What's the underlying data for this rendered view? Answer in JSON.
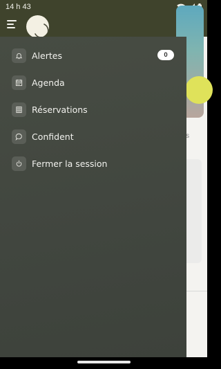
{
  "status_bar": {
    "time": "14 h 43",
    "icons": [
      "wifi-icon",
      "signal-icon",
      "battery-icon"
    ]
  },
  "app_bar": {
    "menu_icon": "hamburger-menu-icon",
    "logo": "app-logo"
  },
  "drawer": {
    "items": [
      {
        "label": "Alertes",
        "icon": "bell-icon",
        "badge": "0"
      },
      {
        "label": "Agenda",
        "icon": "calendar-icon"
      },
      {
        "label": "Réservations",
        "icon": "reservations-icon"
      },
      {
        "label": "Confident",
        "icon": "chat-bubble-icon"
      },
      {
        "label": "Fermer la session",
        "icon": "power-icon"
      }
    ]
  },
  "underlay": {
    "partial_text": "ous"
  },
  "colors": {
    "header": "#3f432c",
    "drawer": "#444940",
    "text": "#f2f2ee",
    "badge": "#ffffff"
  }
}
